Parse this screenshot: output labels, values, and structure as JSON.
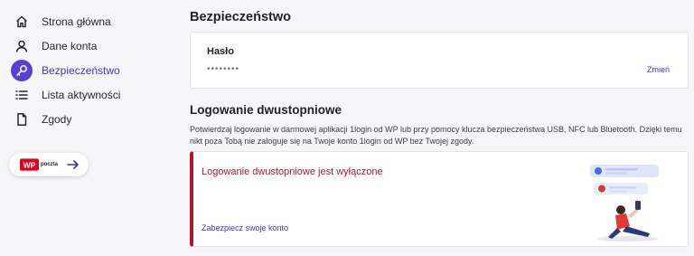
{
  "sidebar": {
    "items": [
      {
        "label": "Strona główna",
        "icon": "home-icon"
      },
      {
        "label": "Dane konta",
        "icon": "user-icon"
      },
      {
        "label": "Bezpieczeństwo",
        "icon": "key-icon",
        "active": true
      },
      {
        "label": "Lista aktywności",
        "icon": "list-icon"
      },
      {
        "label": "Zgody",
        "icon": "document-icon"
      }
    ],
    "poczta": {
      "logo_text": "WP",
      "label": "poczta",
      "icon": "arrow-right-icon"
    }
  },
  "security": {
    "title": "Bezpieczeństwo",
    "password": {
      "label": "Hasło",
      "value": "••••••••",
      "change": "Zmień"
    }
  },
  "twofa": {
    "title": "Logowanie dwustopniowe",
    "description": "Potwierdzaj logowanie w darmowej aplikacji 1login od WP lub przy pomocy klucza bezpieczeństwa USB, NFC lub Bluetooth. Dzięki temu nikt poza Tobą nie zaloguje się na Twoje konto 1login od WP bez Twojej zgody.",
    "status": "Logowanie dwustopniowe jest wyłączone",
    "link": "Zabezpiecz swoje konto"
  },
  "colors": {
    "accent": "#4a32c8",
    "active_bg": "#5a3fd6",
    "danger": "#b0182a",
    "background": "#f6f6f8"
  }
}
